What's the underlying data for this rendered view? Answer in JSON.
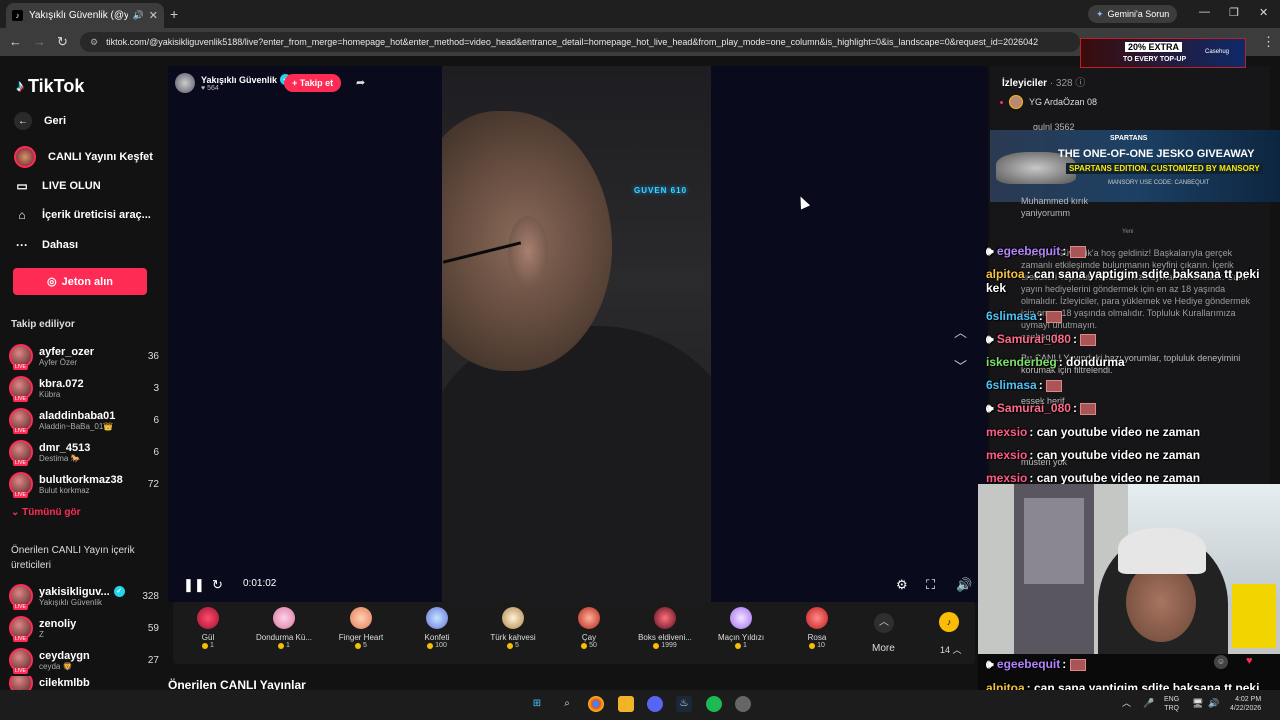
{
  "browser": {
    "tab_title": "Yakışıklı Güvenlik (@yakisi",
    "gemini_label": "Gemini'a Sorun",
    "url": "tiktok.com/@yakisikliguvenlik5188/live?enter_from_merge=homepage_hot&enter_method=video_head&entrance_detail=homepage_hot_live_head&from_play_mode=one_column&is_highlight=0&is_landscape=0&request_id=2026042"
  },
  "sidebar": {
    "logo": "TikTok",
    "nav": [
      {
        "label": "Geri"
      },
      {
        "label": "CANLI Yayını Keşfet"
      },
      {
        "label": "LIVE OLUN"
      },
      {
        "label": "İçerik üreticisi araç..."
      },
      {
        "label": "Dahası"
      }
    ],
    "coin_button": "Jeton alın",
    "following_title": "Takip ediliyor",
    "following": [
      {
        "name": "ayfer_ozer",
        "sub": "Ayfer Özer",
        "count": "36"
      },
      {
        "name": "kbra.072",
        "sub": "Kübra",
        "count": "3"
      },
      {
        "name": "aladdinbaba01",
        "sub": "Aladdin~BaBa_01👑",
        "count": "6"
      },
      {
        "name": "dmr_4513",
        "sub": "Destima 🐎",
        "count": "6"
      },
      {
        "name": "bulutkorkmaz38",
        "sub": "Bulut korkmaz",
        "count": "72"
      }
    ],
    "see_all": "Tümünü gör",
    "recommended_title": "Önerilen CANLI Yayın içerik üreticileri",
    "recommended": [
      {
        "name": "yakisikliguv...",
        "sub": "Yakışıklı Güvenlik",
        "count": "328"
      },
      {
        "name": "zenoliy",
        "sub": "Z",
        "count": "59"
      },
      {
        "name": "ceydaygn",
        "sub": "ceyda 🦁",
        "count": "27"
      },
      {
        "name": "cilekmlbb",
        "sub": "",
        "count": ""
      }
    ]
  },
  "live": {
    "host_name": "Yakışıklı Güvenlik",
    "host_likes": "564",
    "follow_label": "+ Takip et",
    "elapsed": "0:01:02",
    "video_sign": "GUVEN 610"
  },
  "gifts": [
    {
      "name": "Gül",
      "price": "1"
    },
    {
      "name": "Dondurma Kü...",
      "price": "1"
    },
    {
      "name": "Finger Heart",
      "price": "5"
    },
    {
      "name": "Konfeti",
      "price": "100"
    },
    {
      "name": "Türk kahvesi",
      "price": "5"
    },
    {
      "name": "Çay",
      "price": "50"
    },
    {
      "name": "Boks eldiveni...",
      "price": "1999"
    },
    {
      "name": "Maçın Yıldızı",
      "price": "1"
    },
    {
      "name": "Rosa",
      "price": "10"
    }
  ],
  "more_label": "More",
  "coin_count": "14",
  "recs_title": "Önerilen CANLI Yayınlar",
  "chat": {
    "viewers_label": "İzleyiciler",
    "viewers_count": "· 328",
    "top_viewer": "YG ArdaÖzan 08",
    "partial_viewer": "gulnl 3562",
    "dim_user": "Muhammed kırık",
    "dim_text": "yaniyorumm",
    "new_label": "Yeni",
    "welcome_text": "Yakışıklı Güvenlik'a hoş geldiniz! Başkalarıyla gerçek zamanlı etkileşimde bulunmanın keyfini çıkarın. İçerik üreticileri Topluluk Kurallarımıza uymak zorundadır. Canlı yayın hediyelerini göndermek için en az 18 yaşında olmalıdır. İzleyiciler, para yüklemek ve Hediye göndermek için en az 18 yaşında olmalıdır. Topluluk Kurallarımıza uymayı unutmayın.",
    "dim_canbequit": "canbequit",
    "dim_filter": "Bu CANLI Yayındaki bazı yorumlar, topluluk deneyimini korumak için filtrelendi.",
    "dim_esek": "essek herif",
    "dim_musteri": "müsteri yok"
  },
  "overlay": [
    {
      "user": "egeebequit",
      "text": "",
      "color": "#b583ff"
    },
    {
      "user": "alpitoa",
      "text": ": can sana yaptigim sdite baksana tt peki kek",
      "color": "#f5c242"
    },
    {
      "user": "6slimasa",
      "text": ":",
      "color": "#4fc3f7"
    },
    {
      "user": "Samurai_080",
      "text": ":",
      "color": "#ff6b8a"
    },
    {
      "user": "iskenderbeg",
      "text": ": dondurma",
      "color": "#7be36b"
    },
    {
      "user": "6slimasa",
      "text": ":",
      "color": "#4fc3f7"
    },
    {
      "user": "Samurai_080",
      "text": ":",
      "color": "#ff6b8a"
    },
    {
      "user": "mexsio",
      "text": ": can youtube video ne zaman",
      "color": "#ff5a8a"
    },
    {
      "user": "mexsio",
      "text": ": can youtube video ne zaman",
      "color": "#ff5a8a"
    },
    {
      "user": "mexsio",
      "text": ": can youtube video ne zaman",
      "color": "#ff5a8a"
    }
  ],
  "bottom_chat": [
    {
      "user": "egeebequit",
      "text": ":",
      "color": "#b583ff"
    },
    {
      "user": "alpitoa",
      "text": ": can sana yaptigim sdite baksana tt peki kek",
      "color": "#f5c242"
    }
  ],
  "ads": {
    "top_pct": "20% EXTRA",
    "top_msg": "TO EVERY TOP-UP",
    "top_brand": "Casehug",
    "banner_brand": "SPARTANS",
    "banner_h1": "THE ONE-OF-ONE JESKO GIVEAWAY",
    "banner_h2": "SPARTANS EDITION. CUSTOMIZED BY MANSORY",
    "banner_h3": "MANSORY   USE CODE: CANBEQUIT"
  },
  "taskbar": {
    "lang1": "ENG",
    "lang2": "TRQ",
    "time": "4:02 PM",
    "date": "4/22/2026"
  }
}
